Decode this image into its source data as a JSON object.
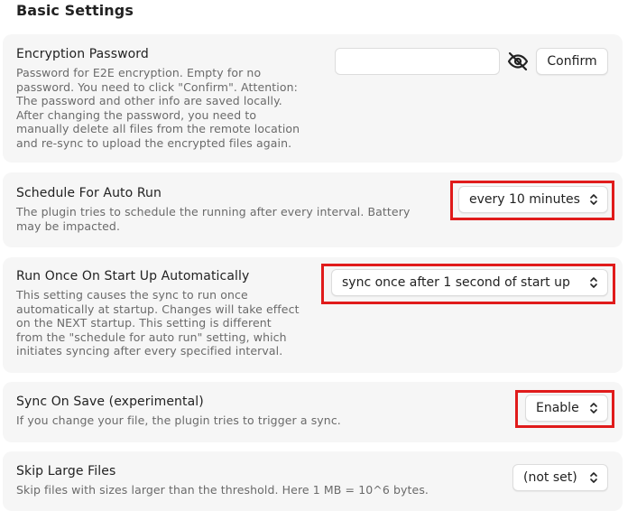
{
  "section": {
    "title": "Basic Settings"
  },
  "settings": {
    "encryption": {
      "name": "Encryption Password",
      "desc_lines": [
        "Password for E2E encryption. Empty for no",
        "password. You need to click \"Confirm\". Attention:",
        "The password and other info are saved locally.",
        "After changing the password, you need to",
        "manually delete all files from the remote location",
        "and re-sync to upload the encrypted files again."
      ],
      "input_value": "",
      "visibility_icon": "eye-off-icon",
      "confirm_label": "Confirm"
    },
    "schedule": {
      "name": "Schedule For Auto Run",
      "desc_lines": [
        "The plugin tries to schedule the running after every interval. Battery",
        "may be impacted."
      ],
      "selected": "every 10 minutes"
    },
    "startup": {
      "name": "Run Once On Start Up Automatically",
      "desc_lines": [
        "This setting causes the sync to run once",
        "automatically at startup. Changes will take effect",
        "on the NEXT startup. This setting is different",
        "from the \"schedule for auto run\" setting, which",
        "initiates syncing after every specified interval."
      ],
      "selected": "sync once after 1 second of start up"
    },
    "sync_on_save": {
      "name": "Sync On Save (experimental)",
      "desc_lines": [
        "If you change your file, the plugin tries to trigger a sync."
      ],
      "selected": "Enable"
    },
    "skip_large": {
      "name": "Skip Large Files",
      "desc_lines": [
        "Skip files with sizes larger than the threshold. Here 1 MB = 10^6 bytes."
      ],
      "selected": "(not set)"
    }
  },
  "colors": {
    "highlight": "#e01b1b",
    "card_background": "#f6f6f6",
    "description_text": "#6a6a6a"
  }
}
